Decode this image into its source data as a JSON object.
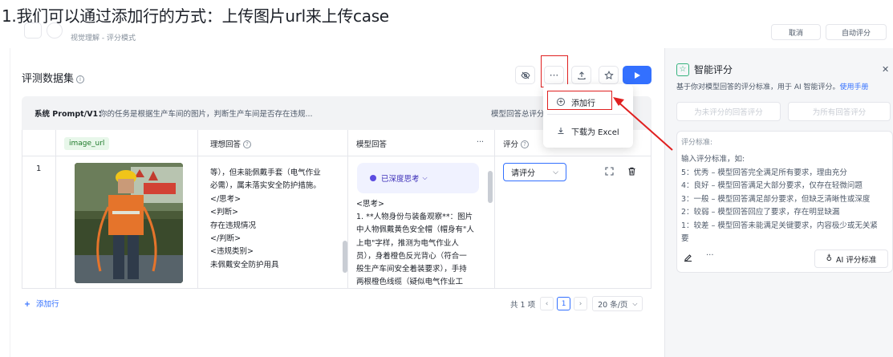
{
  "caption": "1.我们可以通过添加行的方式：上传图片url来上传case",
  "header": {
    "breadcrumb": "视觉理解 - 评分模式",
    "right_buttons": [
      "取消",
      "自动评分"
    ]
  },
  "dataset": {
    "title": "评测数据集",
    "toolbar": {
      "hide_icon": "eye-off-icon",
      "more_label": "···",
      "upload_icon": "upload-icon",
      "star_icon": "star-icon",
      "run_icon": "play-icon"
    },
    "prompt": {
      "label": "系统 Prompt/V1：",
      "text": "你的任务是根据生产车间的图片，判断生产车间是否存在违规...",
      "right_text": "模型回答总评分"
    },
    "columns": {
      "image": "image_url",
      "ideal": "理想回答",
      "model": "模型回答",
      "score": "评分"
    },
    "rows": [
      {
        "index": "1",
        "ideal_lines": [
          "等），但未能佩戴手套（电气作业",
          "必需），属未落实安全防护措施。",
          "</思考>",
          "<判断>",
          "存在违规情况",
          "</判断>",
          "<违规类别>",
          "未佩戴安全防护用具"
        ],
        "model_tag": "已深度思考",
        "model_lines": [
          "<思考>",
          "1. **人物身份与装备观察**：图片",
          "中人物佩戴黄色安全帽（帽身有\"人",
          "上电\"字样，推测为电气作业人",
          "员），身着橙色反光背心（符合一",
          "般生产车间安全着装要求），手持",
          "两根橙色线缆（疑似电气作业工"
        ],
        "score_placeholder": "请评分",
        "fullscreen_icon": "fullscreen-icon",
        "delete_icon": "trash-icon"
      }
    ],
    "add_row": "添加行",
    "pagination": {
      "total": "共 1 项",
      "current_page": "1",
      "page_size": "20 条/页"
    }
  },
  "dropdown": {
    "items": [
      {
        "label": "添加行",
        "icon": "plus-circle-icon"
      },
      {
        "label": "下载为 Excel",
        "icon": "download-icon"
      }
    ]
  },
  "smart_scoring": {
    "title": "智能评分",
    "desc": "基于你对模型回答的评分标准，用于 AI 智能评分。",
    "manual_link": "使用手册",
    "btn_unscored": "为未评分的回答评分",
    "btn_all": "为所有回答评分",
    "criteria_title": "评分标准:",
    "criteria_lines": [
      "输入评分标准，如:",
      "5：优秀 – 模型回答完全满足所有要求，理由充分",
      "4：良好 – 模型回答满足大部分要求，仅存在轻微问题",
      "3：一般 – 模型回答满足部分要求，但缺乏清晰性或深度",
      "2：较弱 – 模型回答回应了要求，存在明显缺漏",
      "1：较差 – 模型回答未能满足关键要求，内容极少或无关紧",
      "要"
    ],
    "ai_btn": "AI 评分标准"
  },
  "colors": {
    "accent": "#3370ff",
    "highlight": "#e02020",
    "model_tag_bg": "#f0f2ff",
    "model_tag_fg": "#3c2fb8"
  }
}
